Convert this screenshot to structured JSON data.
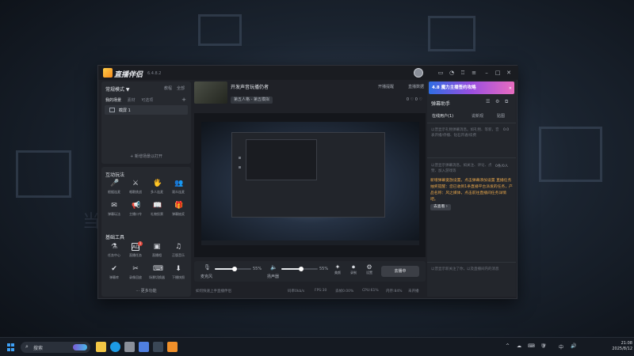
{
  "app": {
    "title": "直播伴侣",
    "version": "6.4.8.2"
  },
  "wallpaper": {
    "side_text": "当"
  },
  "scenes": {
    "mode_label": "常规模式 ▼",
    "tutorial": "教程",
    "full": "全部",
    "tabs": [
      "我的场景",
      "素材",
      "可选项"
    ],
    "add_plus": "+",
    "items": [
      {
        "label": "截屏 1"
      }
    ],
    "add_scene": "+ 新增场景以打开"
  },
  "interactive": {
    "title": "互动玩法",
    "tools": [
      {
        "icon": "🎤",
        "label": "根据连麦"
      },
      {
        "icon": "⚔",
        "label": "唱歌挑战"
      },
      {
        "icon": "🖐",
        "label": "多人连麦"
      },
      {
        "icon": "👥",
        "label": "观众连麦"
      },
      {
        "icon": "✉",
        "label": "弹幕玩法"
      },
      {
        "icon": "📢",
        "label": "主播口令"
      },
      {
        "icon": "📖",
        "label": "礼物投票"
      },
      {
        "icon": "🎁",
        "label": "弹幕抽奖"
      }
    ]
  },
  "basic": {
    "title": "基础工具",
    "tools": [
      {
        "icon": "⚗",
        "label": "任务中心"
      },
      {
        "icon": "AD",
        "label": "直播任务",
        "badge": "1"
      },
      {
        "icon": "▣",
        "label": "直播相"
      },
      {
        "icon": "♫",
        "label": "正版音乐"
      },
      {
        "icon": "✔",
        "label": "弹幕库"
      },
      {
        "icon": "✂",
        "label": "录像回放"
      },
      {
        "icon": "⌨",
        "label": "场景切换器"
      },
      {
        "icon": "⬇",
        "label": "下播快照"
      }
    ],
    "more": "··· 更多功能"
  },
  "stream": {
    "title": "开发声音玩播仍者",
    "category": "第五人格 - 第五模拟",
    "open_live": "开播提醒",
    "live_data": "直播数据",
    "stats": "0 ♡ 0 ♡"
  },
  "controls": {
    "mic_label": "麦克风",
    "mic_percent": "55%",
    "mic_level": 0.55,
    "speaker_label": "扬声器",
    "speaker_percent": "55%",
    "speaker_level": 0.55,
    "buttons": [
      {
        "icon": "✦",
        "label": "美颜"
      },
      {
        "icon": "⏺",
        "label": "录制"
      },
      {
        "icon": "⚙",
        "label": "设置"
      }
    ],
    "go_live": "去播中"
  },
  "status": {
    "tip": "如何快速上手直播伴侣",
    "items": [
      "码率0kb/s",
      "FPS:30",
      "丢帧0.00%",
      "CPU:61%",
      "内存:84%",
      "未开播"
    ]
  },
  "right_panel": {
    "banner": "4.8 魔力主播签约攻略",
    "close": "✕",
    "title": "弹幕助手",
    "tabs": [
      "在线用户(1)",
      "说新观",
      "贴图"
    ],
    "placeholder1": "以普显示礼物弹幕消息。如礼物、等新，音表开播/停播、钻石开通/续费",
    "count1": "0.0",
    "placeholder2": "以普显示弹幕消息。如关注、评论、点赞、加入游戏等",
    "count2": "0条/0人",
    "notice": "新增弹幕宽放设置，点击弹幕添加设置 直播任务抽奖提醒：您已收到1条直播平台派发的任务，产品名称：风之媒体，点击前往直播间任务详情吧。",
    "notice_btn": "去查看 ›",
    "placeholder3": "以普显示新关注了你，以及直播间内的消息"
  },
  "taskbar": {
    "search_label": "搜索",
    "apps": [
      {
        "name": "file-explorer",
        "color": "#f3c745"
      },
      {
        "name": "edge",
        "color": "#1d9be5"
      },
      {
        "name": "settings",
        "color": "#8a8f99"
      },
      {
        "name": "store",
        "color": "#4f7fe0"
      },
      {
        "name": "steam",
        "color": "#3a4756"
      },
      {
        "name": "live-companion",
        "color": "#f0902a"
      }
    ],
    "tray": [
      "^",
      "☁",
      "⌨",
      "🛡",
      "🔊",
      "中"
    ],
    "time": "21:08",
    "date": "2025/8/12"
  }
}
